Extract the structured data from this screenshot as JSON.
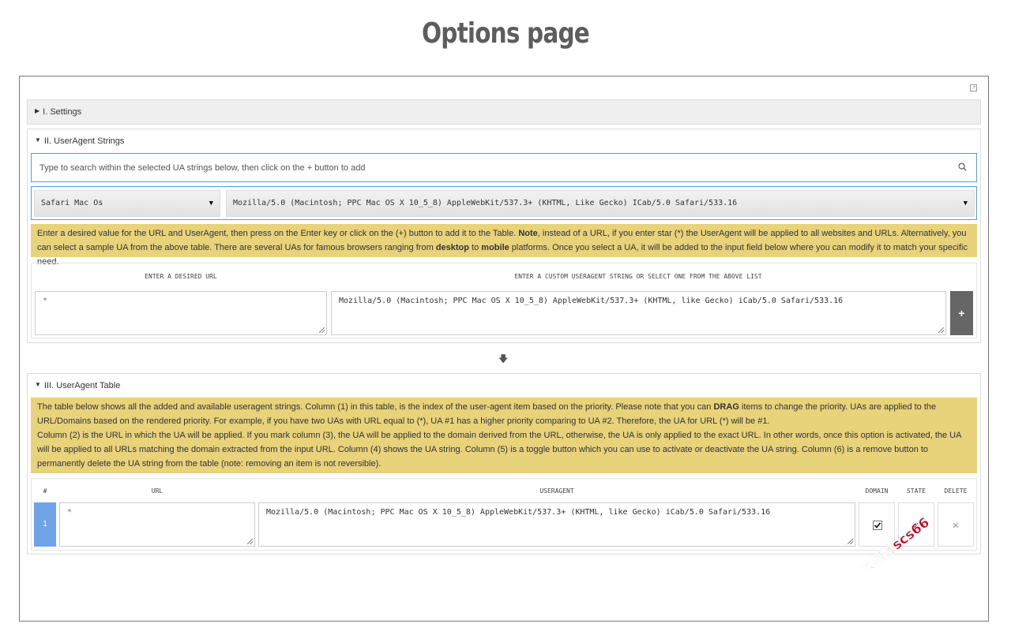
{
  "page_title": "Options page",
  "sections": {
    "settings": {
      "label": "I. Settings"
    },
    "ua_strings": {
      "label": "II. UserAgent Strings",
      "search_placeholder": "Type to search within the selected UA strings below, then click on the + button to add",
      "browser_select": "Safari Mac Os",
      "ua_select": "Mozilla/5.0 (Macintosh; PPC Mac OS X 10_5_8) AppleWebKit/537.3+ (KHTML, Like Gecko) ICab/5.0 Safari/533.16",
      "note": {
        "p1": "Enter a desired value for the URL and UserAgent, then press on the Enter key or click on the (+) button to add it to the Table. ",
        "b1": "Note",
        "p2": ", instead of a URL, if you enter star (*) the UserAgent will be applied to all websites and URLs. Alternatively, you can select a sample UA from the above table. There are several UAs for famous browsers ranging from ",
        "b2": "desktop",
        "p3": " to ",
        "b3": "mobile",
        "p4": " platforms. Once you select a UA, it will be added to the input field below where you can modify it to match your specific need."
      },
      "url_header": "ENTER A DESIRED URL",
      "ua_header": "ENTER A CUSTOM USERAGENT STRING OR SELECT ONE FROM THE ABOVE LIST",
      "url_value": "*",
      "ua_value": "Mozilla/5.0 (Macintosh; PPC Mac OS X 10_5_8) AppleWebKit/537.3+ (KHTML, like Gecko) iCab/5.0 Safari/533.16",
      "add_label": "+"
    },
    "ua_table": {
      "label": "III. UserAgent Table",
      "note": {
        "p1": "The table below shows all the added and available useragent strings. Column (1) in this table, is the index of the user-agent item based on the priority. Please note that you can ",
        "b1": "DRAG",
        "p2": " items to change the priority. UAs are applied to the URL/Domains based on the rendered priority. For example, if you have two UAs with URL equal to (*), UA #1 has a higher priority comparing to UA #2. Therefore, the UA for URL (*) will be #1.",
        "p3": "Column (2) is the URL in which the UA will be applied. If you mark column (3), the UA will be applied to the domain derived from the URL, otherwise, the UA is only applied to the exact URL. In other words, once this option is activated, the UA will be applied to all URLs matching the domain extracted from the input URL. Column (4) shows the UA string. Column (5) is a toggle button which you can use to activate or deactivate the UA string. Column (6) is a remove button to permanently delete the UA string from the table (note: removing an item is not reversible)."
      },
      "headers": {
        "index": "#",
        "url": "URL",
        "useragent": "USERAGENT",
        "domain": "DOMAIN",
        "state": "STATE",
        "delete": "DELETE"
      },
      "rows": [
        {
          "index": "1",
          "url": "*",
          "useragent": "Mozilla/5.0 (Macintosh; PPC Mac OS X 10_5_8) AppleWebKit/537.3+ (KHTML, like Gecko) iCab/5.0 Safari/533.16",
          "domain_checked": true,
          "state_glyph": "✓",
          "delete_glyph": "✕"
        }
      ]
    }
  },
  "watermark": "数创社scs66"
}
